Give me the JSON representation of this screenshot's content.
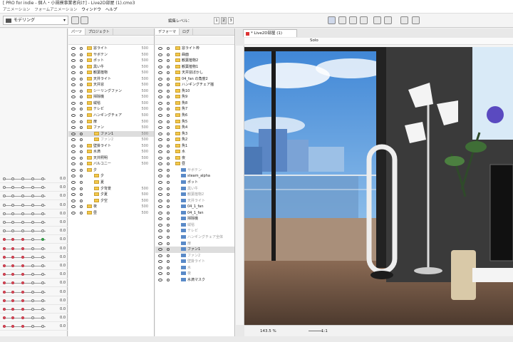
{
  "title": "[ PRO for indie - 個人・小規模事業者向け] - Live2D部屋 (1).cmo3",
  "menu": [
    "アニメーション",
    "フォームアニメーション",
    "ウィンドウ",
    "ヘルプ"
  ],
  "mode_select": "モデリング",
  "edit_level": {
    "label": "編集レベル：",
    "levels": [
      "1",
      "2",
      "3"
    ]
  },
  "parts_panel": {
    "tabs": [
      "パーツ",
      "プロジェクト"
    ],
    "rows": [
      {
        "name": "窓ライト",
        "num": "500",
        "indent": 0
      },
      {
        "name": "サボテン",
        "num": "500",
        "indent": 0
      },
      {
        "name": "ポット",
        "num": "500",
        "indent": 0
      },
      {
        "name": "黒い牛",
        "num": "500",
        "indent": 0
      },
      {
        "name": "観葉植物",
        "num": "500",
        "indent": 0
      },
      {
        "name": "天井ライト",
        "num": "500",
        "indent": 0
      },
      {
        "name": "天井窓",
        "num": "500",
        "indent": 0
      },
      {
        "name": "シーリングファン",
        "num": "500",
        "indent": 0
      },
      {
        "name": "掃除機",
        "num": "500",
        "indent": 0
      },
      {
        "name": "絨毯",
        "num": "500",
        "indent": 0
      },
      {
        "name": "テレビ",
        "num": "500",
        "indent": 0
      },
      {
        "name": "ハンギングチェア",
        "num": "500",
        "indent": 0
      },
      {
        "name": "扉",
        "num": "500",
        "indent": 0
      },
      {
        "name": "ファン",
        "num": "500",
        "indent": 0
      },
      {
        "name": "ファン1",
        "num": "500",
        "indent": 1,
        "sel": true
      },
      {
        "name": "ファン2",
        "num": "500",
        "indent": 1,
        "dim": true
      },
      {
        "name": "壁掛ライト",
        "num": "500",
        "indent": 0
      },
      {
        "name": "水滴",
        "num": "500",
        "indent": 0
      },
      {
        "name": "天井照明",
        "num": "500",
        "indent": 0
      },
      {
        "name": "バルコニー",
        "num": "500",
        "indent": 0
      },
      {
        "name": "夕",
        "num": "",
        "indent": 0
      },
      {
        "name": "夕",
        "num": "",
        "indent": 1
      },
      {
        "name": "夏",
        "num": "",
        "indent": 1
      },
      {
        "name": "夕背景",
        "num": "500",
        "indent": 1
      },
      {
        "name": "夕夏",
        "num": "500",
        "indent": 1
      },
      {
        "name": "夕空",
        "num": "500",
        "indent": 1
      },
      {
        "name": "夜",
        "num": "500",
        "indent": 0
      },
      {
        "name": "昼",
        "num": "500",
        "indent": 0
      }
    ]
  },
  "deformer_panel": {
    "tabs": [
      "デフォーマ",
      "ログ"
    ],
    "rows": [
      {
        "name": "窓ライト枠",
        "indent": 1
      },
      {
        "name": "曲面",
        "indent": 1
      },
      {
        "name": "観葉植物2",
        "indent": 1
      },
      {
        "name": "観葉植物1",
        "indent": 1
      },
      {
        "name": "天井窓ぼかし",
        "indent": 1
      },
      {
        "name": "04_fan の角度2",
        "indent": 1
      },
      {
        "name": "ハンギングチェア揺",
        "indent": 1
      },
      {
        "name": "魚10",
        "indent": 1
      },
      {
        "name": "魚9",
        "indent": 1
      },
      {
        "name": "魚8",
        "indent": 1
      },
      {
        "name": "魚7",
        "indent": 1
      },
      {
        "name": "魚6",
        "indent": 1
      },
      {
        "name": "魚5",
        "indent": 1
      },
      {
        "name": "魚4",
        "indent": 1
      },
      {
        "name": "魚3",
        "indent": 1
      },
      {
        "name": "魚2",
        "indent": 1
      },
      {
        "name": "魚1",
        "indent": 1
      },
      {
        "name": "水",
        "indent": 1
      },
      {
        "name": "夜",
        "indent": 1
      },
      {
        "name": "昼",
        "indent": 1
      },
      {
        "name": "サボテン",
        "indent": 2,
        "dim": true
      },
      {
        "name": "steam_alpha",
        "indent": 2
      },
      {
        "name": "ポット",
        "indent": 2
      },
      {
        "name": "黒い牛",
        "indent": 2,
        "dim": true
      },
      {
        "name": "観葉植物2",
        "indent": 2,
        "dim": true
      },
      {
        "name": "天井ライト",
        "indent": 2,
        "dim": true
      },
      {
        "name": "04_1_fan",
        "indent": 2
      },
      {
        "name": "04_1_fan",
        "indent": 2
      },
      {
        "name": "掃除機",
        "indent": 2
      },
      {
        "name": "絨毯",
        "indent": 2,
        "dim": true
      },
      {
        "name": "テレビ",
        "indent": 2,
        "dim": true
      },
      {
        "name": "ハンギングチェア全体",
        "indent": 2,
        "dim": true
      },
      {
        "name": "扉",
        "indent": 2,
        "dim": true
      },
      {
        "name": "ファン1",
        "indent": 2,
        "sel": true
      },
      {
        "name": "ファン2",
        "indent": 2,
        "dim": true
      },
      {
        "name": "壁掛ライト",
        "indent": 2,
        "dim": true
      },
      {
        "name": "水",
        "indent": 2,
        "dim": true
      },
      {
        "name": "夜",
        "indent": 2,
        "dim": true
      },
      {
        "name": "水滴マスク",
        "indent": 2
      }
    ]
  },
  "canvas": {
    "tab": "* Live2D部屋 (1)",
    "solo": "Solo",
    "zoom": "143.5 %",
    "ratio": "1:1"
  },
  "left_values": [
    "0.0",
    "0.0",
    "0.0",
    "0.0",
    "0.0",
    "0.0",
    "0.0",
    "0.0",
    "0.0",
    "0.0",
    "0.0",
    "0.0",
    "0.0",
    "0.0",
    "0.0",
    "0.0",
    "0.0",
    "0.0"
  ]
}
